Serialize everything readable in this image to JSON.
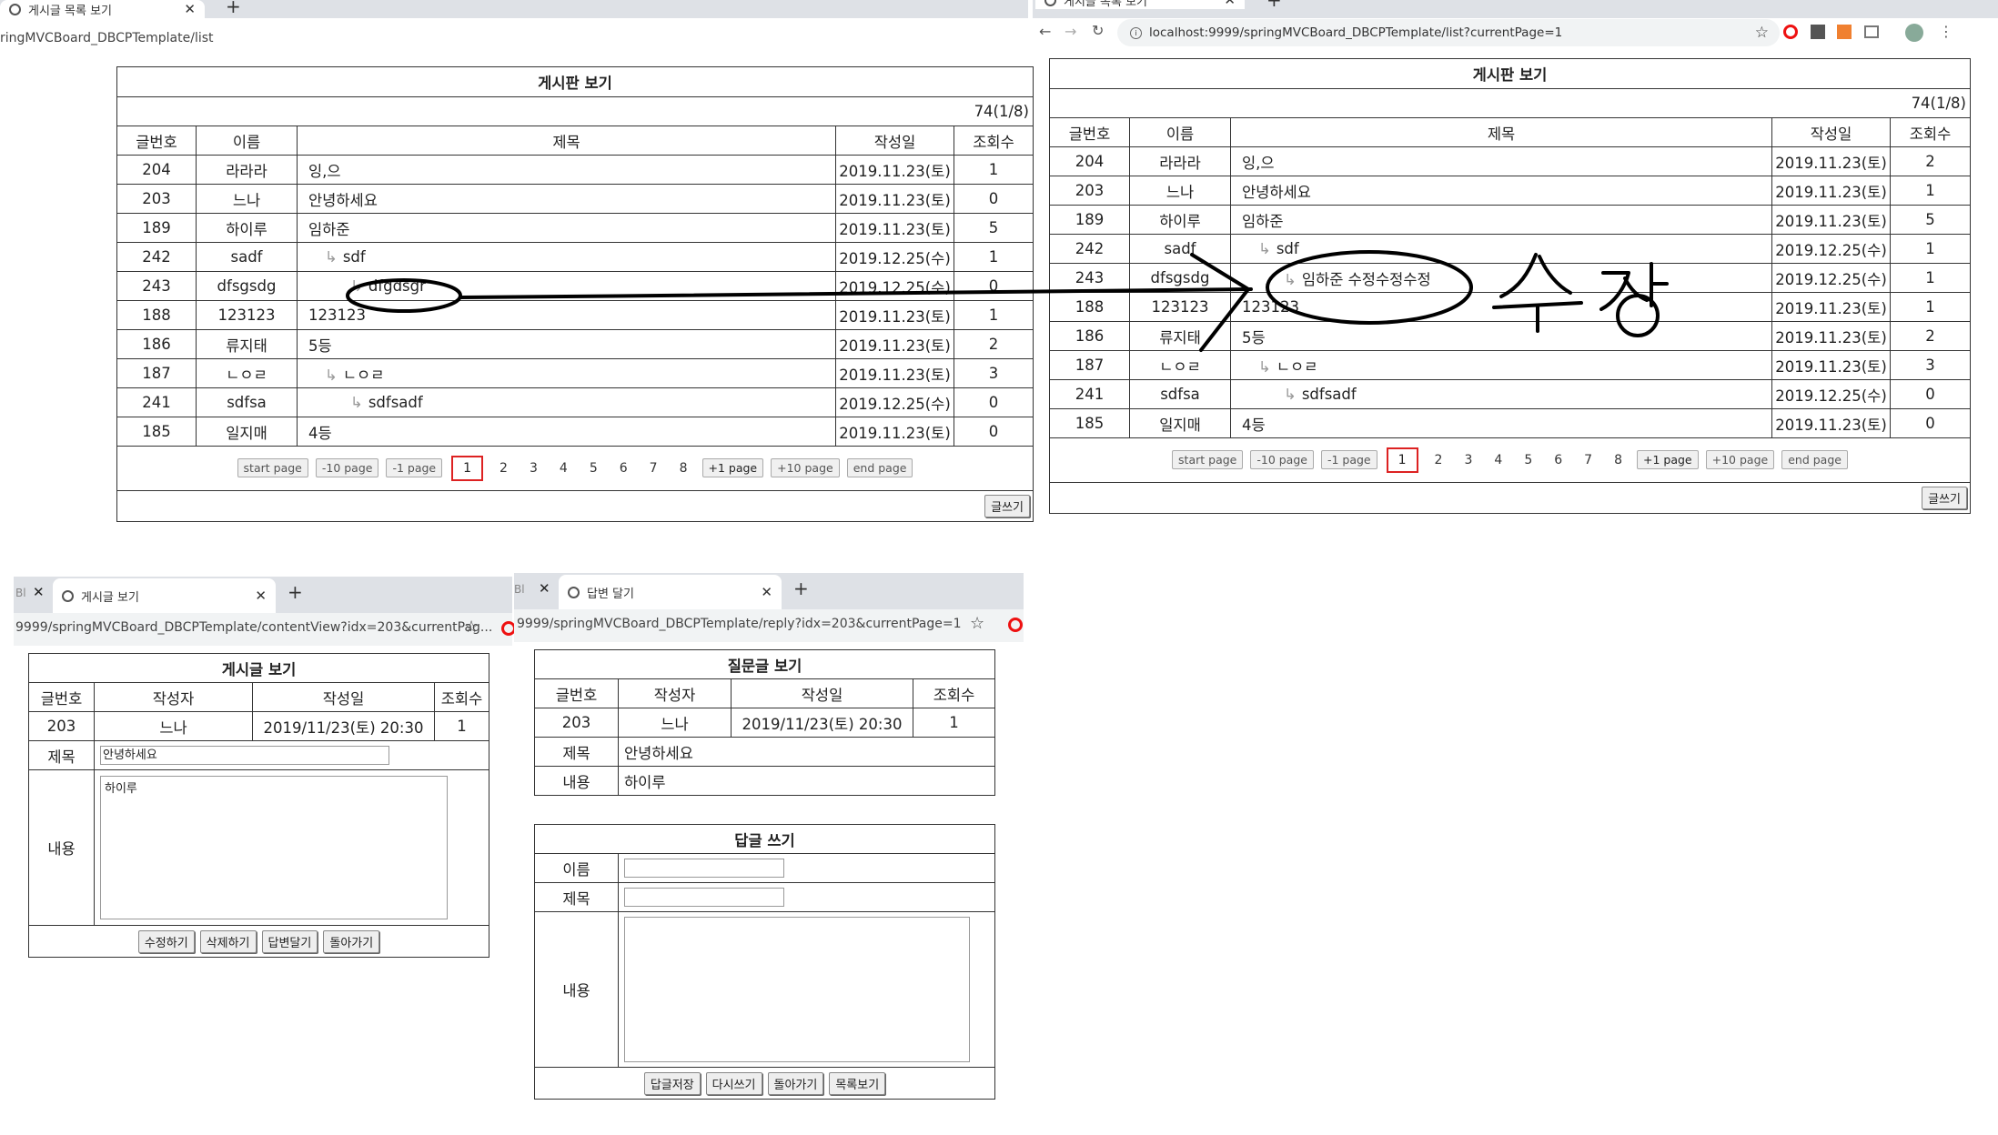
{
  "win1": {
    "tab_title": "게시글 목록 보기",
    "url": "ringMVCBoard_DBCPTemplate/list"
  },
  "win2": {
    "tab_title": "게시글 목록 보기",
    "url": "localhost:9999/springMVCBoard_DBCPTemplate/list?currentPage=1"
  },
  "win3": {
    "prev_tab": "Bl",
    "tab_title": "게시글 보기",
    "url": "9999/springMVCBoard_DBCPTemplate/contentView?idx=203&currentPag..."
  },
  "win4": {
    "prev_tab": "Bl",
    "tab_title": "답변 달기",
    "url": "9999/springMVCBoard_DBCPTemplate/reply?idx=203&currentPage=1"
  },
  "list": {
    "title": "게시판 보기",
    "count": "74(1/8)",
    "headers": [
      "글번호",
      "이름",
      "제목",
      "작성일",
      "조회수"
    ],
    "prev_pages": [
      "start page",
      "-10 page",
      "-1 page"
    ],
    "current_page": "1",
    "pages": [
      "2",
      "3",
      "4",
      "5",
      "6",
      "7",
      "8"
    ],
    "next_pages": [
      "+1 page",
      "+10 page",
      "end page"
    ],
    "write_button": "글쓰기"
  },
  "left_rows": [
    {
      "idx": "204",
      "name": "라라라",
      "reply": "",
      "title": "잉,으",
      "date": "2019.11.23(토)",
      "hits": "1"
    },
    {
      "idx": "203",
      "name": "느나",
      "reply": "",
      "title": "안녕하세요",
      "date": "2019.11.23(토)",
      "hits": "0"
    },
    {
      "idx": "189",
      "name": "하이루",
      "reply": "",
      "title": "임하준",
      "date": "2019.11.23(토)",
      "hits": "5"
    },
    {
      "idx": "242",
      "name": "sadf",
      "reply": "↳",
      "title": "sdf",
      "date": "2019.12.25(수)",
      "hits": "1"
    },
    {
      "idx": "243",
      "name": "dfsgsdg",
      "reply": "↳",
      "title": "dfgdsgr",
      "date": "2019.12.25(수)",
      "hits": "0"
    },
    {
      "idx": "188",
      "name": "123123",
      "reply": "",
      "title": "123123",
      "date": "2019.11.23(토)",
      "hits": "1"
    },
    {
      "idx": "186",
      "name": "류지태",
      "reply": "",
      "title": "5등",
      "date": "2019.11.23(토)",
      "hits": "2"
    },
    {
      "idx": "187",
      "name": "ㄴㅇㄹ",
      "reply": "↳",
      "title": "ㄴㅇㄹ",
      "date": "2019.11.23(토)",
      "hits": "3"
    },
    {
      "idx": "241",
      "name": "sdfsa",
      "reply": "↳",
      "title": "sdfsadf",
      "date": "2019.12.25(수)",
      "hits": "0"
    },
    {
      "idx": "185",
      "name": "일지매",
      "reply": "",
      "title": "4등",
      "date": "2019.11.23(토)",
      "hits": "0"
    }
  ],
  "right_rows": [
    {
      "idx": "204",
      "name": "라라라",
      "reply": "",
      "title": "잉,으",
      "date": "2019.11.23(토)",
      "hits": "2"
    },
    {
      "idx": "203",
      "name": "느나",
      "reply": "",
      "title": "안녕하세요",
      "date": "2019.11.23(토)",
      "hits": "1"
    },
    {
      "idx": "189",
      "name": "하이루",
      "reply": "",
      "title": "임하준",
      "date": "2019.11.23(토)",
      "hits": "5"
    },
    {
      "idx": "242",
      "name": "sadf",
      "reply": "↳",
      "title": "sdf",
      "date": "2019.12.25(수)",
      "hits": "1"
    },
    {
      "idx": "243",
      "name": "dfsgsdg",
      "reply": "↳",
      "title": "임하준 수정수정수정",
      "date": "2019.12.25(수)",
      "hits": "1"
    },
    {
      "idx": "188",
      "name": "123123",
      "reply": "",
      "title": "123123",
      "date": "2019.11.23(토)",
      "hits": "1"
    },
    {
      "idx": "186",
      "name": "류지태",
      "reply": "",
      "title": "5등",
      "date": "2019.11.23(토)",
      "hits": "2"
    },
    {
      "idx": "187",
      "name": "ㄴㅇㄹ",
      "reply": "↳",
      "title": "ㄴㅇㄹ",
      "date": "2019.11.23(토)",
      "hits": "3"
    },
    {
      "idx": "241",
      "name": "sdfsa",
      "reply": "↳",
      "title": "sdfsadf",
      "date": "2019.12.25(수)",
      "hits": "0"
    },
    {
      "idx": "185",
      "name": "일지매",
      "reply": "",
      "title": "4등",
      "date": "2019.11.23(토)",
      "hits": "0"
    }
  ],
  "content_view": {
    "title": "게시글 보기",
    "headers": [
      "글번호",
      "작성자",
      "작성일",
      "조회수"
    ],
    "values": [
      "203",
      "느나",
      "2019/11/23(토) 20:30",
      "1"
    ],
    "subject_label": "제목",
    "subject_value": "안녕하세요",
    "content_label": "내용",
    "content_value": "하이루",
    "buttons": [
      "수정하기",
      "삭제하기",
      "답변달기",
      "돌아가기"
    ]
  },
  "question_view": {
    "title": "질문글 보기",
    "headers": [
      "글번호",
      "작성자",
      "작성일",
      "조회수"
    ],
    "values": [
      "203",
      "느나",
      "2019/11/23(토) 20:30",
      "1"
    ],
    "subject_label": "제목",
    "subject_value": "안녕하세요",
    "content_label": "내용",
    "content_value": "하이루"
  },
  "reply_form": {
    "title": "답글 쓰기",
    "name_label": "이름",
    "subject_label": "제목",
    "content_label": "내용",
    "buttons": [
      "답글저장",
      "다시쓰기",
      "돌아가기",
      "목록보기"
    ]
  }
}
